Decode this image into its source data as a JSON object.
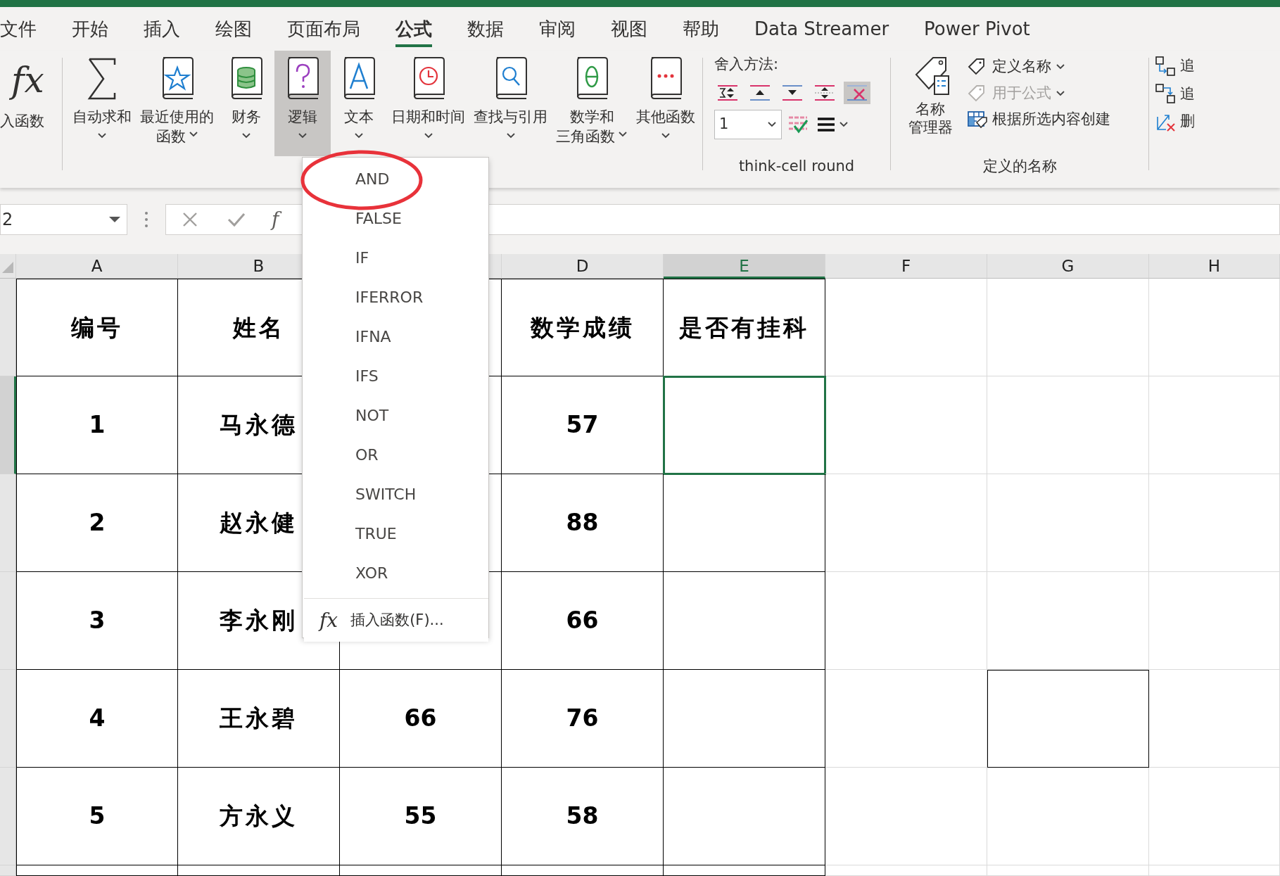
{
  "tabs": [
    {
      "label": "文件",
      "selected": false
    },
    {
      "label": "开始",
      "selected": false
    },
    {
      "label": "插入",
      "selected": false
    },
    {
      "label": "绘图",
      "selected": false
    },
    {
      "label": "页面布局",
      "selected": false
    },
    {
      "label": "公式",
      "selected": true
    },
    {
      "label": "数据",
      "selected": false
    },
    {
      "label": "审阅",
      "selected": false
    },
    {
      "label": "视图",
      "selected": false
    },
    {
      "label": "帮助",
      "selected": false
    },
    {
      "label": "Data Streamer",
      "selected": false
    },
    {
      "label": "Power Pivot",
      "selected": false
    }
  ],
  "function_library": {
    "insert_function": {
      "icon_text": "fx",
      "lines": [
        "入函数"
      ]
    },
    "buttons": [
      {
        "kind": "sum",
        "lines": [
          "自动求和"
        ],
        "dropdown": true,
        "selected": false
      },
      {
        "kind": "star",
        "lines": [
          "最近使用的",
          "函数"
        ],
        "dropdown": true,
        "selected": false
      },
      {
        "kind": "database",
        "lines": [
          "财务"
        ],
        "dropdown": true,
        "selected": false
      },
      {
        "kind": "question",
        "lines": [
          "逻辑"
        ],
        "dropdown": true,
        "selected": true
      },
      {
        "kind": "letter",
        "lines": [
          "文本"
        ],
        "dropdown": true,
        "selected": false
      },
      {
        "kind": "clock",
        "lines": [
          "日期和时间"
        ],
        "dropdown": true,
        "selected": false
      },
      {
        "kind": "search",
        "lines": [
          "查找与引用"
        ],
        "dropdown": true,
        "selected": false
      },
      {
        "kind": "theta",
        "lines": [
          "数学和",
          "三角函数"
        ],
        "dropdown": true,
        "selected": false
      },
      {
        "kind": "dots",
        "lines": [
          "其他函数"
        ],
        "dropdown": true,
        "selected": false
      }
    ]
  },
  "think_cell": {
    "label": "舍入方法:",
    "round_buttons": [
      {
        "kind": "sum-both",
        "selected": false
      },
      {
        "kind": "up",
        "selected": false
      },
      {
        "kind": "down",
        "selected": false
      },
      {
        "kind": "both",
        "selected": false
      },
      {
        "kind": "remove",
        "selected": true
      }
    ],
    "digits": {
      "value": "1"
    },
    "group_label": "think-cell round"
  },
  "defined_names": {
    "manager": {
      "lines": [
        "名称",
        "管理器"
      ]
    },
    "items": [
      {
        "kind": "tag",
        "label": "定义名称",
        "dropdown": true,
        "disabled": false
      },
      {
        "kind": "formula-tag",
        "label": "用于公式",
        "dropdown": true,
        "disabled": true
      },
      {
        "kind": "table",
        "label": "根据所选内容创建",
        "dropdown": false,
        "disabled": false
      }
    ],
    "group_label": "定义的名称"
  },
  "auditing": {
    "items": [
      {
        "kind": "trace-precedents",
        "label": "追"
      },
      {
        "kind": "trace-dependents",
        "label": "追"
      },
      {
        "kind": "remove-arrows",
        "label": "删"
      }
    ]
  },
  "formula_bar": {
    "name_box": "2",
    "fx": "f"
  },
  "sheet": {
    "columns": [
      "A",
      "B",
      null,
      "D",
      "E",
      "F",
      "G",
      "H"
    ],
    "rows": [
      {
        "cells": [
          {
            "text": "编号",
            "selected": false,
            "boxed": true
          },
          {
            "text": "姓名",
            "selected": false,
            "boxed": true
          },
          {
            "selected": false,
            "boxed": true
          },
          {
            "text": "数学成绩",
            "selected": false,
            "boxed": true
          },
          {
            "text": "是否有挂科",
            "selected": false,
            "boxed": true
          },
          {
            "selected": false,
            "boxed": false
          },
          {
            "selected": false,
            "boxed": false
          },
          {
            "selected": false,
            "boxed": false
          }
        ]
      },
      {
        "cells": [
          {
            "text": "1",
            "selected": false,
            "boxed": true
          },
          {
            "text": "马永德",
            "selected": false,
            "boxed": true
          },
          {
            "selected": false,
            "boxed": true
          },
          {
            "text": "57",
            "selected": false,
            "boxed": true
          },
          {
            "selected": true,
            "boxed": true
          },
          {
            "selected": false,
            "boxed": false
          },
          {
            "selected": false,
            "boxed": false
          },
          {
            "selected": false,
            "boxed": false
          }
        ]
      },
      {
        "cells": [
          {
            "text": "2",
            "selected": false,
            "boxed": true
          },
          {
            "text": "赵永健",
            "selected": false,
            "boxed": true
          },
          {
            "selected": false,
            "boxed": true
          },
          {
            "text": "88",
            "selected": false,
            "boxed": true
          },
          {
            "selected": false,
            "boxed": true
          },
          {
            "selected": false,
            "boxed": false
          },
          {
            "selected": false,
            "boxed": false
          },
          {
            "selected": false,
            "boxed": false
          }
        ]
      },
      {
        "cells": [
          {
            "text": "3",
            "selected": false,
            "boxed": true
          },
          {
            "text": "李永刚",
            "selected": false,
            "boxed": true
          },
          {
            "selected": false,
            "boxed": true
          },
          {
            "text": "66",
            "selected": false,
            "boxed": true
          },
          {
            "selected": false,
            "boxed": true
          },
          {
            "selected": false,
            "boxed": false
          },
          {
            "selected": false,
            "boxed": false
          },
          {
            "selected": false,
            "boxed": false
          }
        ]
      },
      {
        "cells": [
          {
            "text": "4",
            "selected": false,
            "boxed": true
          },
          {
            "text": "王永碧",
            "selected": false,
            "boxed": true
          },
          {
            "text": "66",
            "selected": false,
            "boxed": true
          },
          {
            "text": "76",
            "selected": false,
            "boxed": true
          },
          {
            "selected": false,
            "boxed": true
          },
          {
            "selected": false,
            "boxed": false
          },
          {
            "selected": false,
            "boxed": true
          },
          {
            "selected": false,
            "boxed": false
          }
        ]
      },
      {
        "cells": [
          {
            "text": "5",
            "selected": false,
            "boxed": true
          },
          {
            "text": "方永义",
            "selected": false,
            "boxed": true
          },
          {
            "text": "55",
            "selected": false,
            "boxed": true
          },
          {
            "text": "58",
            "selected": false,
            "boxed": true
          },
          {
            "selected": false,
            "boxed": true
          },
          {
            "selected": false,
            "boxed": false
          },
          {
            "selected": false,
            "boxed": false
          },
          {
            "selected": false,
            "boxed": false
          }
        ]
      },
      {
        "cells": [
          {
            "selected": false,
            "boxed": true
          },
          {
            "selected": false,
            "boxed": true
          },
          {
            "selected": false,
            "boxed": true
          },
          {
            "selected": false,
            "boxed": true
          },
          {
            "selected": false,
            "boxed": true
          },
          {
            "selected": false,
            "boxed": false
          },
          {
            "selected": false,
            "boxed": false
          },
          {
            "selected": false,
            "boxed": false
          }
        ]
      }
    ]
  },
  "logic_menu": {
    "items": [
      {
        "label": "AND"
      },
      {
        "label": "FALSE"
      },
      {
        "label": "IF"
      },
      {
        "label": "IFERROR"
      },
      {
        "label": "IFNA"
      },
      {
        "label": "IFS"
      },
      {
        "label": "NOT"
      },
      {
        "label": "OR"
      },
      {
        "label": "SWITCH"
      },
      {
        "label": "TRUE"
      },
      {
        "label": "XOR"
      }
    ],
    "footer": {
      "icon_text": "fx",
      "label": "插入函数(F)..."
    }
  }
}
